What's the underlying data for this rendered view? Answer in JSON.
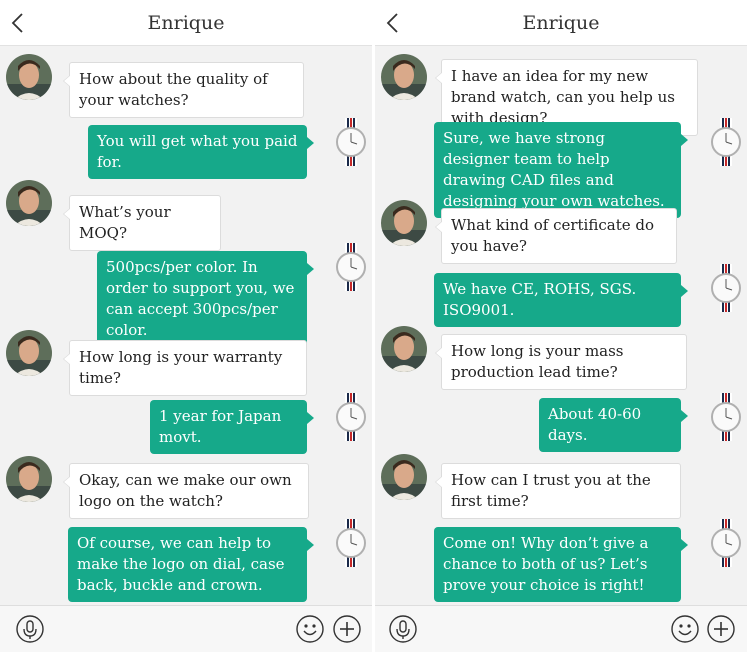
{
  "icons": {
    "back": "chevron-left-icon",
    "mic": "microphone-icon",
    "emoji": "smiley-icon",
    "add": "plus-icon"
  },
  "colors": {
    "accent": "#16a98a",
    "background": "#f2f2f2"
  },
  "left": {
    "title": "Enrique",
    "messages": [
      {
        "side": "in",
        "text": "How about the quality of your watches?"
      },
      {
        "side": "out",
        "text": "You will get what you paid for."
      },
      {
        "side": "in",
        "text": "What’s your MOQ?"
      },
      {
        "side": "out",
        "text": "500pcs/per color. In order to support you, we can accept 300pcs/per color."
      },
      {
        "side": "in",
        "text": "How long is your warranty time?"
      },
      {
        "side": "out",
        "text": "1 year for Japan movt."
      },
      {
        "side": "in",
        "text": "Okay, can we make our own logo on the watch?"
      },
      {
        "side": "out",
        "text": "Of course, we can help to make the logo on dial, case back, buckle and crown."
      }
    ]
  },
  "right": {
    "title": "Enrique",
    "messages": [
      {
        "side": "in",
        "text": "I have an idea for my new brand watch, can you help us with design?"
      },
      {
        "side": "out",
        "text": "Sure, we have strong designer team to help drawing CAD files and designing your own watches."
      },
      {
        "side": "in",
        "text": "What kind of certificate do you have?"
      },
      {
        "side": "out",
        "text": "We have CE, ROHS, SGS. ISO9001."
      },
      {
        "side": "in",
        "text": "How long is your mass production lead time?"
      },
      {
        "side": "out",
        "text": "About 40-60 days."
      },
      {
        "side": "in",
        "text": "How can I trust you at the first time?"
      },
      {
        "side": "out",
        "text": "Come on! Why don’t give a chance to both of us? Let’s prove your choice is right!"
      }
    ]
  }
}
